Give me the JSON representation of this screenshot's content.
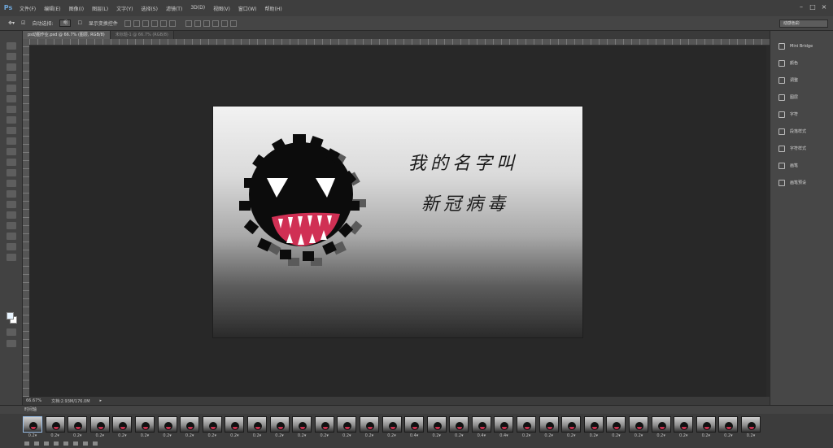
{
  "app": {
    "logo": "Ps"
  },
  "menubar": {
    "items": [
      "文件(F)",
      "编辑(E)",
      "图像(I)",
      "图层(L)",
      "文字(Y)",
      "选择(S)",
      "滤镜(T)",
      "3D(D)",
      "视图(V)",
      "窗口(W)",
      "帮助(H)"
    ],
    "window_controls": [
      "–",
      "□",
      "×"
    ]
  },
  "options_bar": {
    "auto_select_label": "自动选择:",
    "auto_select_value": "组",
    "show_transform_label": "显示变换控件",
    "workspace_label": "动感色彩"
  },
  "tabs": [
    {
      "label": "ps动图作业.psd @ 66.7% (图层, RGB/8)"
    },
    {
      "label": "未标题-1 @ 66.7% (RGB/8)"
    }
  ],
  "document": {
    "line1": "我的名字叫",
    "line2": "新冠病毒"
  },
  "status": {
    "zoom": "66.67%",
    "doc_size": "文档:2.93M/176.0M"
  },
  "right_panel": {
    "items": [
      {
        "label": "Mini Bridge",
        "icon": "bridge-icon"
      },
      {
        "label": "颜色",
        "icon": "color-icon"
      },
      {
        "label": "调整",
        "icon": "adjust-icon"
      },
      {
        "label": "图层",
        "icon": "layers-icon"
      },
      {
        "label": "字符",
        "icon": "character-icon"
      },
      {
        "label": "段落样式",
        "icon": "paragraph-style-icon"
      },
      {
        "label": "字符样式",
        "icon": "character-style-icon"
      },
      {
        "label": "画笔",
        "icon": "brush-icon"
      },
      {
        "label": "画笔预设",
        "icon": "brush-preset-icon"
      }
    ]
  },
  "timeline": {
    "title": "时间轴",
    "frames": [
      "0.2▾",
      "0.2▾",
      "0.2▾",
      "0.2▾",
      "0.2▾",
      "0.2▾",
      "0.2▾",
      "0.2▾",
      "0.2▾",
      "0.2▾",
      "0.2▾",
      "0.2▾",
      "0.2▾",
      "0.2▾",
      "0.2▾",
      "0.2▾",
      "0.2▾",
      "0.4▾",
      "0.2▾",
      "0.2▾",
      "0.4▾",
      "0.4▾",
      "0.2▾",
      "0.2▾",
      "0.2▾",
      "0.2▾",
      "0.2▾",
      "0.2▾",
      "0.2▾",
      "0.2▾",
      "0.2▾",
      "0.2▾",
      "0.2▾"
    ]
  },
  "colors": {
    "accent_frame": "#9bbfe8",
    "virus_mouth": "#c8324f"
  }
}
